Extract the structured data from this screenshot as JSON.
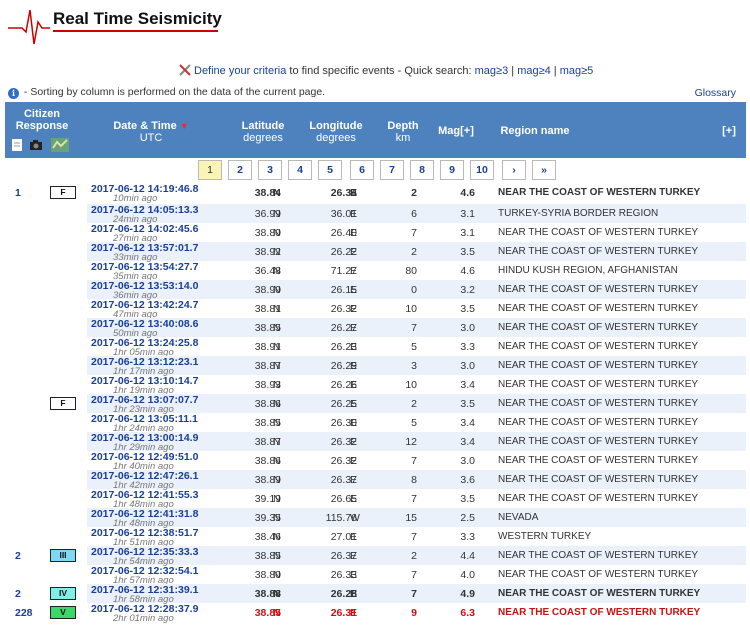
{
  "header": {
    "title": "Real Time Seismicity"
  },
  "criteria": {
    "link": "Define your criteria",
    "text": " to find specific events - Quick search: ",
    "q1": "mag≥3",
    "sep1": " | ",
    "q2": "mag≥4",
    "sep2": " | ",
    "q3": "mag≥5"
  },
  "info": {
    "text": "- Sorting by column is performed on the data of the current page."
  },
  "glossary": "Glossary",
  "table_header": {
    "citizen": "Citizen",
    "response": "Response",
    "datetime": "Date & Time",
    "utc": "UTC",
    "sort_indicator": "▼",
    "latitude": "Latitude",
    "lat_unit": "degrees",
    "longitude": "Longitude",
    "lon_unit": "degrees",
    "depth": "Depth",
    "depth_unit": "km",
    "mag": "Mag[+]",
    "region": "Region name",
    "expand": "[+]"
  },
  "pager": [
    "1",
    "2",
    "3",
    "4",
    "5",
    "6",
    "7",
    "8",
    "9",
    "10",
    "›",
    "»"
  ],
  "rows": [
    {
      "resp": "1",
      "badge": "F",
      "badge_color": "#ffffff",
      "date": "2017-06-12   14:19:46.8",
      "ago": "10min ago",
      "lat": "38.84",
      "ns": "N",
      "lon": "26.34",
      "ew": "E",
      "depth": "2",
      "mag": "4.6",
      "region": "NEAR THE COAST OF WESTERN TURKEY",
      "style": "bold"
    },
    {
      "resp": "",
      "badge": "",
      "date": "2017-06-12   14:05:13.3",
      "ago": "24min ago",
      "lat": "36.99",
      "ns": "N",
      "lon": "36.01",
      "ew": "E",
      "depth": "6",
      "mag": "3.1",
      "region": "TURKEY-SYRIA BORDER REGION",
      "style": ""
    },
    {
      "resp": "",
      "badge": "",
      "date": "2017-06-12   14:02:45.6",
      "ago": "27min ago",
      "lat": "38.80",
      "ns": "N",
      "lon": "26.40",
      "ew": "E",
      "depth": "7",
      "mag": "3.1",
      "region": "NEAR THE COAST OF WESTERN TURKEY",
      "style": ""
    },
    {
      "resp": "",
      "badge": "",
      "date": "2017-06-12   13:57:01.7",
      "ago": "33min ago",
      "lat": "38.92",
      "ns": "N",
      "lon": "26.22",
      "ew": "E",
      "depth": "2",
      "mag": "3.5",
      "region": "NEAR THE COAST OF WESTERN TURKEY",
      "style": ""
    },
    {
      "resp": "",
      "badge": "",
      "date": "2017-06-12   13:54:27.7",
      "ago": "35min ago",
      "lat": "36.48",
      "ns": "N",
      "lon": "71.27",
      "ew": "E",
      "depth": "80",
      "mag": "4.6",
      "region": "HINDU KUSH REGION, AFGHANISTAN",
      "style": ""
    },
    {
      "resp": "",
      "badge": "",
      "date": "2017-06-12   13:53:14.0",
      "ago": "36min ago",
      "lat": "38.90",
      "ns": "N",
      "lon": "26.15",
      "ew": "E",
      "depth": "0",
      "mag": "3.2",
      "region": "NEAR THE COAST OF WESTERN TURKEY",
      "style": ""
    },
    {
      "resp": "",
      "badge": "",
      "date": "2017-06-12   13:42:24.7",
      "ago": "47min ago",
      "lat": "38.81",
      "ns": "N",
      "lon": "26.32",
      "ew": "E",
      "depth": "10",
      "mag": "3.5",
      "region": "NEAR THE COAST OF WESTERN TURKEY",
      "style": ""
    },
    {
      "resp": "",
      "badge": "",
      "date": "2017-06-12   13:40:08.6",
      "ago": "50min ago",
      "lat": "38.85",
      "ns": "N",
      "lon": "26.27",
      "ew": "E",
      "depth": "7",
      "mag": "3.0",
      "region": "NEAR THE COAST OF WESTERN TURKEY",
      "style": ""
    },
    {
      "resp": "",
      "badge": "",
      "date": "2017-06-12   13:24:25.8",
      "ago": "1hr 05min ago",
      "lat": "38.91",
      "ns": "N",
      "lon": "26.23",
      "ew": "E",
      "depth": "5",
      "mag": "3.3",
      "region": "NEAR THE COAST OF WESTERN TURKEY",
      "style": ""
    },
    {
      "resp": "",
      "badge": "",
      "date": "2017-06-12   13:12:23.1",
      "ago": "1hr 17min ago",
      "lat": "38.87",
      "ns": "N",
      "lon": "26.29",
      "ew": "E",
      "depth": "3",
      "mag": "3.0",
      "region": "NEAR THE COAST OF WESTERN TURKEY",
      "style": ""
    },
    {
      "resp": "",
      "badge": "",
      "date": "2017-06-12   13:10:14.7",
      "ago": "1hr 19min ago",
      "lat": "38.93",
      "ns": "N",
      "lon": "26.26",
      "ew": "E",
      "depth": "10",
      "mag": "3.4",
      "region": "NEAR THE COAST OF WESTERN TURKEY",
      "style": ""
    },
    {
      "resp": "",
      "badge": "F",
      "badge_color": "#ffffff",
      "date": "2017-06-12   13:07:07.7",
      "ago": "1hr 23min ago",
      "lat": "38.86",
      "ns": "N",
      "lon": "26.25",
      "ew": "E",
      "depth": "2",
      "mag": "3.5",
      "region": "NEAR THE COAST OF WESTERN TURKEY",
      "style": ""
    },
    {
      "resp": "",
      "badge": "",
      "date": "2017-06-12   13:05:11.1",
      "ago": "1hr 24min ago",
      "lat": "38.85",
      "ns": "N",
      "lon": "26.30",
      "ew": "E",
      "depth": "5",
      "mag": "3.4",
      "region": "NEAR THE COAST OF WESTERN TURKEY",
      "style": ""
    },
    {
      "resp": "",
      "badge": "",
      "date": "2017-06-12   13:00:14.9",
      "ago": "1hr 29min ago",
      "lat": "38.87",
      "ns": "N",
      "lon": "26.32",
      "ew": "E",
      "depth": "12",
      "mag": "3.4",
      "region": "NEAR THE COAST OF WESTERN TURKEY",
      "style": ""
    },
    {
      "resp": "",
      "badge": "",
      "date": "2017-06-12   12:49:51.0",
      "ago": "1hr 40min ago",
      "lat": "38.86",
      "ns": "N",
      "lon": "26.32",
      "ew": "E",
      "depth": "7",
      "mag": "3.0",
      "region": "NEAR THE COAST OF WESTERN TURKEY",
      "style": ""
    },
    {
      "resp": "",
      "badge": "",
      "date": "2017-06-12   12:47:26.1",
      "ago": "1hr 42min ago",
      "lat": "38.89",
      "ns": "N",
      "lon": "26.37",
      "ew": "E",
      "depth": "8",
      "mag": "3.6",
      "region": "NEAR THE COAST OF WESTERN TURKEY",
      "style": ""
    },
    {
      "resp": "",
      "badge": "",
      "date": "2017-06-12   12:41:55.3",
      "ago": "1hr 48min ago",
      "lat": "39.19",
      "ns": "N",
      "lon": "26.65",
      "ew": "E",
      "depth": "7",
      "mag": "3.5",
      "region": "NEAR THE COAST OF WESTERN TURKEY",
      "style": ""
    },
    {
      "resp": "",
      "badge": "",
      "date": "2017-06-12   12:41:31.8",
      "ago": "1hr 48min ago",
      "lat": "39.35",
      "ns": "N",
      "lon": "115.76",
      "ew": "W",
      "depth": "15",
      "mag": "2.5",
      "region": "NEVADA",
      "style": ""
    },
    {
      "resp": "",
      "badge": "",
      "date": "2017-06-12   12:38:51.7",
      "ago": "1hr 51min ago",
      "lat": "38.46",
      "ns": "N",
      "lon": "27.01",
      "ew": "E",
      "depth": "7",
      "mag": "3.3",
      "region": "WESTERN TURKEY",
      "style": ""
    },
    {
      "resp": "2",
      "badge": "III",
      "badge_color": "#7fd8f5",
      "date": "2017-06-12   12:35:33.3",
      "ago": "1hr 54min ago",
      "lat": "38.85",
      "ns": "N",
      "lon": "26.37",
      "ew": "E",
      "depth": "2",
      "mag": "4.4",
      "region": "NEAR THE COAST OF WESTERN TURKEY",
      "style": ""
    },
    {
      "resp": "",
      "badge": "",
      "date": "2017-06-12   12:32:54.1",
      "ago": "1hr 57min ago",
      "lat": "38.80",
      "ns": "N",
      "lon": "26.33",
      "ew": "E",
      "depth": "7",
      "mag": "4.0",
      "region": "NEAR THE COAST OF WESTERN TURKEY",
      "style": ""
    },
    {
      "resp": "2",
      "badge": "IV",
      "badge_color": "#7ff0e8",
      "date": "2017-06-12   12:31:39.1",
      "ago": "1hr 58min ago",
      "lat": "38.88",
      "ns": "N",
      "lon": "26.28",
      "ew": "E",
      "depth": "7",
      "mag": "4.9",
      "region": "NEAR THE COAST OF WESTERN TURKEY",
      "style": "bold"
    },
    {
      "resp": "228",
      "badge": "V",
      "badge_color": "#3ad86a",
      "date": "2017-06-12   12:28:37.9",
      "ago": "2hr 01min ago",
      "lat": "38.85",
      "ns": "N",
      "lon": "26.31",
      "ew": "E",
      "depth": "9",
      "mag": "6.3",
      "region": "NEAR THE COAST OF WESTERN TURKEY",
      "style": "bold red"
    }
  ]
}
